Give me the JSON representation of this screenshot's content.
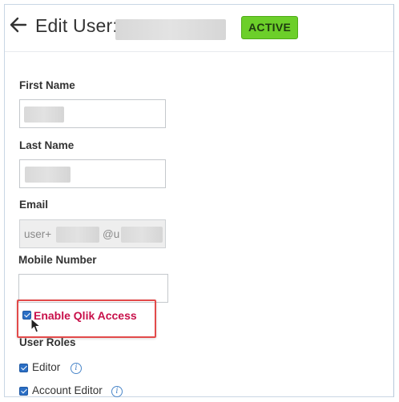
{
  "header": {
    "title": "Edit User:",
    "status_badge": "ACTIVE",
    "colors": {
      "badge_bg": "#6ccf2a",
      "badge_text": "#1f3b10"
    }
  },
  "form": {
    "first_name": {
      "label": "First Name"
    },
    "last_name": {
      "label": "Last Name"
    },
    "email": {
      "label": "Email",
      "value_prefix": "user+",
      "value_at": "@u"
    },
    "mobile": {
      "label": "Mobile Number",
      "value": ""
    },
    "enable_qlik": {
      "label": "Enable Qlik Access",
      "checked": true,
      "color": "#c8104a"
    },
    "user_roles": {
      "label": "User Roles",
      "roles": [
        {
          "label": "Editor",
          "checked": true,
          "info_icon": "info-icon"
        },
        {
          "label": "Account Editor",
          "checked": true,
          "info_icon": "info-icon"
        }
      ]
    }
  },
  "icons": {
    "back": "arrow-left-icon",
    "info_glyph": "i",
    "cursor": "mouse-pointer-icon"
  },
  "highlight_color": "#e24a4a"
}
